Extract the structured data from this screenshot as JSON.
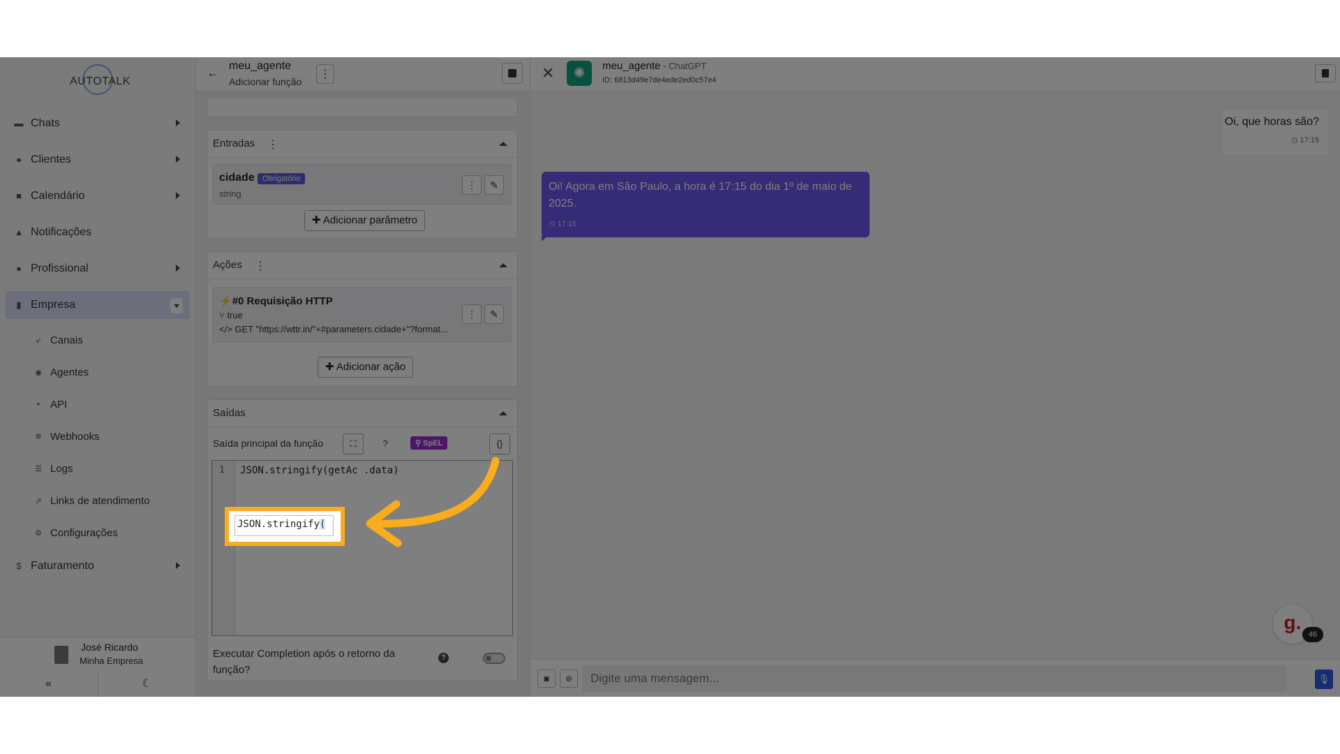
{
  "sidebar": {
    "logo": "AUTOTALK",
    "items": [
      {
        "label": "Chats",
        "icon": "chat-icon"
      },
      {
        "label": "Clientes",
        "icon": "users-icon"
      },
      {
        "label": "Calendário",
        "icon": "calendar-icon"
      },
      {
        "label": "Notificações",
        "icon": "bell-icon"
      },
      {
        "label": "Profissional",
        "icon": "professional-icon"
      },
      {
        "label": "Empresa",
        "icon": "building-icon"
      }
    ],
    "sub_items": [
      {
        "label": "Canais",
        "icon": "rocket-icon"
      },
      {
        "label": "Agentes",
        "icon": "robot-icon"
      },
      {
        "label": "API",
        "icon": "api-icon"
      },
      {
        "label": "Webhooks",
        "icon": "webhook-icon"
      },
      {
        "label": "Logs",
        "icon": "list-icon"
      },
      {
        "label": "Links de atendimento",
        "icon": "external-link-icon"
      },
      {
        "label": "Configurações",
        "icon": "gear-icon"
      }
    ],
    "billing": {
      "label": "Faturamento",
      "icon": "dollar-icon"
    },
    "user": {
      "name": "José Ricardo",
      "company": "Minha Empresa"
    }
  },
  "editor": {
    "title": "meu_agente",
    "subtitle": "Adicionar função",
    "inputs": {
      "title": "Entradas",
      "param_name": "cidade",
      "param_badge": "Obrigatório",
      "param_type": "string",
      "add_label": "Adicionar parâmetro"
    },
    "actions": {
      "title": "Ações",
      "action_title": "#0 Requisição HTTP",
      "condition": "true",
      "request": "GET \"https://wttr.in/\"+#parameters.cidade+\"?format...",
      "add_label": "Adicionar ação"
    },
    "outputs": {
      "title": "Saídas",
      "main_label": "Saída principal da função",
      "spel_badge": "SpEL",
      "line_number": "1",
      "code": "JSON.stringify(getAc          .data)",
      "highlight_code_prefix": "JSON.stringify",
      "highlight_code_paren": "(",
      "exec_label": "Executar Completion após o retorno da função?"
    }
  },
  "chat": {
    "title": "meu_agente",
    "model": " - ChatGPT",
    "id": "ID: 6813d49e7de4ede2ed0c57e4",
    "user_message": "Oi, que horas são?",
    "user_time": "17:15",
    "bot_message": "Oi! Agora em São Paulo, a hora é 17:15 do dia 1º de maio de 2025.",
    "bot_time": "17:15",
    "input_placeholder": "Digite uma mensagem...",
    "widget_letter": "g.",
    "widget_count": "46"
  },
  "colors": {
    "highlight": "#f9ac1d",
    "bot_bubble": "#6b56ee",
    "badge": "#5c5cd6",
    "spel": "#9b2ccf"
  }
}
